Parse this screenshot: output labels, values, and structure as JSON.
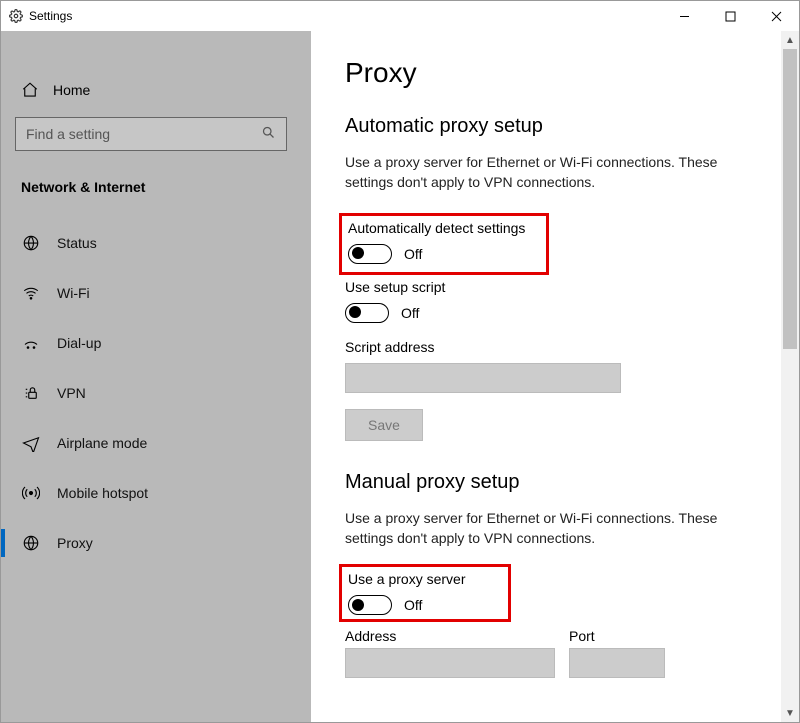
{
  "window": {
    "title": "Settings"
  },
  "sidebar": {
    "home": "Home",
    "search_placeholder": "Find a setting",
    "category": "Network & Internet",
    "items": [
      {
        "label": "Status",
        "icon": "status"
      },
      {
        "label": "Wi-Fi",
        "icon": "wifi"
      },
      {
        "label": "Dial-up",
        "icon": "dialup"
      },
      {
        "label": "VPN",
        "icon": "vpn"
      },
      {
        "label": "Airplane mode",
        "icon": "airplane"
      },
      {
        "label": "Mobile hotspot",
        "icon": "hotspot"
      },
      {
        "label": "Proxy",
        "icon": "proxy",
        "selected": true
      }
    ]
  },
  "page": {
    "title": "Proxy",
    "auto": {
      "heading": "Automatic proxy setup",
      "desc": "Use a proxy server for Ethernet or Wi-Fi connections. These settings don't apply to VPN connections.",
      "auto_detect_label": "Automatically detect settings",
      "auto_detect_state": "Off",
      "use_script_label": "Use setup script",
      "use_script_state": "Off",
      "script_address_label": "Script address",
      "script_address_value": "",
      "save_button": "Save"
    },
    "manual": {
      "heading": "Manual proxy setup",
      "desc": "Use a proxy server for Ethernet or Wi-Fi connections. These settings don't apply to VPN connections.",
      "use_proxy_label": "Use a proxy server",
      "use_proxy_state": "Off",
      "address_label": "Address",
      "address_value": "",
      "port_label": "Port",
      "port_value": ""
    }
  }
}
